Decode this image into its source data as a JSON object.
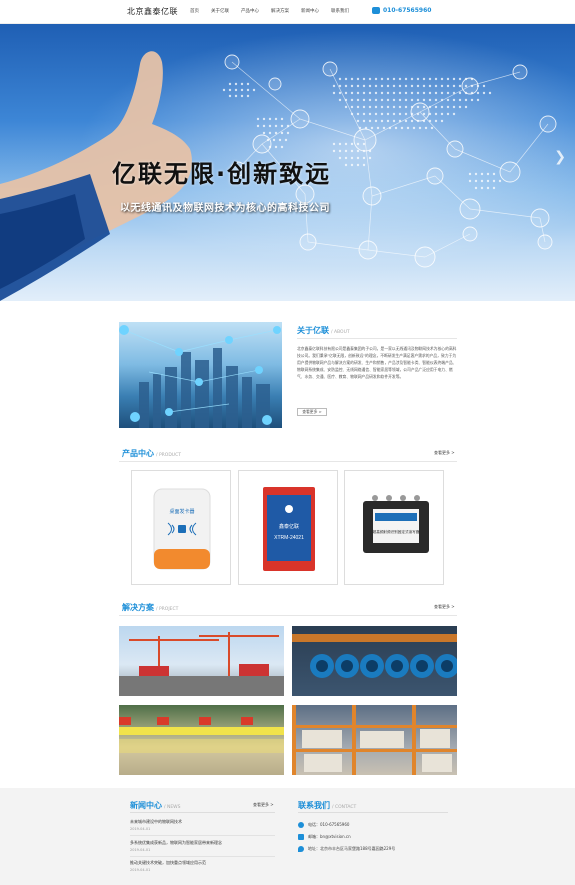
{
  "header": {
    "logo": "北京鑫泰亿联",
    "nav": [
      "首页",
      "关于亿联",
      "产品中心",
      "解决方案",
      "新闻中心",
      "联系我们"
    ],
    "phone": "010-67565960"
  },
  "hero": {
    "title": "亿联无限·创新致远",
    "subtitle": "以无线通讯及物联网技术为核心的高科技公司"
  },
  "about": {
    "title": "关于亿联",
    "title_en": "/ ABOUT",
    "text": "北京鑫泰亿联科技有限公司是鑫泰集团的子公司，是一家以无线通讯及物联网技术为核心的高科技公司。我们秉承\"亿联无限，创新致远\"的理念，不断研发生产满足客户需求的产品，致力于为用户提供物联网产品与解决方案的研发、生产和销售，产品涉及智能卡类、智能仪表终端产品、物联网系统集成、安防监控、无线网络通信、智能家居等领域，公司产品广泛应用于电力、燃气、水务、交通、医疗、教育、物联网产品研发和软件开发等。",
    "more": "查看更多 >"
  },
  "products": {
    "title": "产品中心",
    "title_en": "/ PRODUCT",
    "more": "查看更多 >",
    "items": [
      {
        "name": "桌面发卡器",
        "icon": "card-reader-icon"
      },
      {
        "name": "XTRM-24021",
        "label": "鑫泰亿联",
        "icon": "rf-module-icon"
      },
      {
        "name": "超高频射频识别固定式读写器",
        "icon": "rfid-reader-icon"
      }
    ]
  },
  "solutions": {
    "title": "解决方案",
    "title_en": "/ PROJECT",
    "more": "查看更多 >"
  },
  "news": {
    "title": "新闻中心",
    "title_en": "/ NEWS",
    "more": "查看更多 >",
    "items": [
      {
        "title": "未来城市建设中的物联网技术",
        "date": "2019-04-01"
      },
      {
        "title": "多系统优集成获新品，物联网为智能家居带来新理念",
        "date": "2019-04-01"
      },
      {
        "title": "推动关键技术突破，加快重点领域应用示范",
        "date": "2019-04-01"
      }
    ]
  },
  "contact": {
    "title": "联系我们",
    "title_en": "/ CONTACT",
    "phone": "电话：010-67565960",
    "email": "邮箱：bn@xtvision.cn",
    "address": "地址：北京市丰台区马家堡路188号嘉园路229号"
  },
  "colors": {
    "accent": "#1d8fd8",
    "footer_bg": "#f3f3f3"
  }
}
